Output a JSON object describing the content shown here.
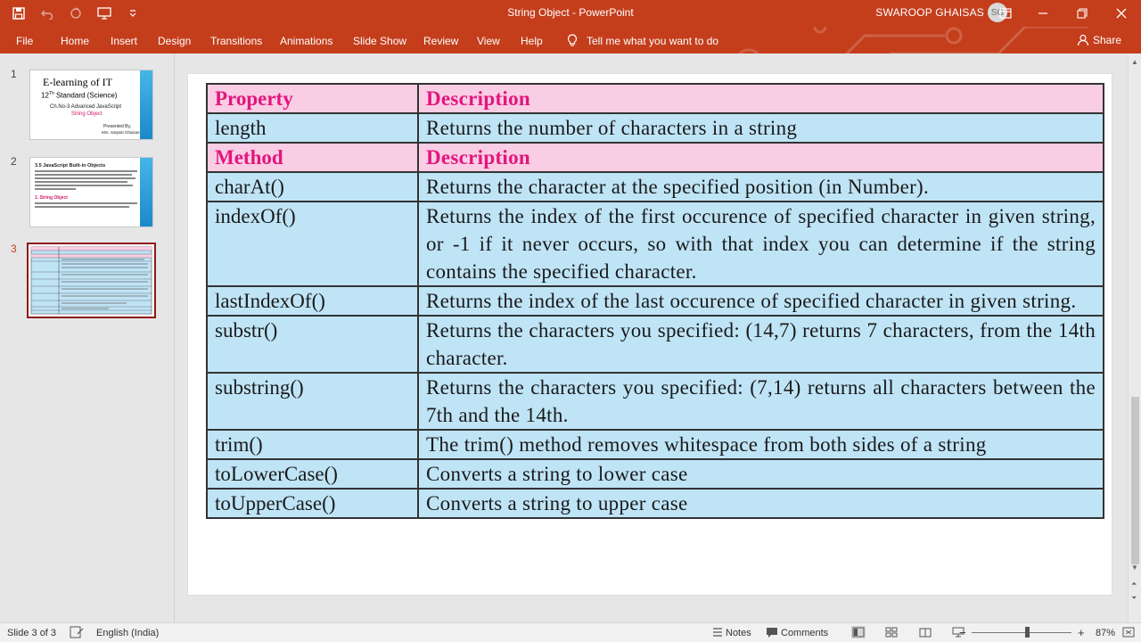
{
  "window": {
    "title": "String Object  -  PowerPoint",
    "user_name": "SWAROOP GHAISAS",
    "user_initials": "SG"
  },
  "ribbon": {
    "tabs": [
      "File",
      "Home",
      "Insert",
      "Design",
      "Transitions",
      "Animations",
      "Slide Show",
      "Review",
      "View",
      "Help"
    ],
    "tell_me": "Tell me what you want to do",
    "share": "Share"
  },
  "thumbnails": {
    "numbers": [
      "1",
      "2",
      "3"
    ],
    "slide1": {
      "title": "E-learning of IT",
      "standard_num": "12",
      "standard_sup": "Th",
      "standard_rest": " Standard (Science)",
      "chapter": "Ch.No-3 Advanced JavaScript",
      "topic": "String Object",
      "presented_by": "Presented By,",
      "presenter": "Mrs. Satyaki Ghaisas"
    },
    "slide2": {
      "title": "3.5 JavaScript Built-in Objects",
      "subheading": "1. String Object"
    }
  },
  "table": {
    "header1": [
      "Property",
      "Description"
    ],
    "header2": [
      "Method",
      "Description"
    ],
    "property_rows": [
      [
        "length",
        "Returns the number of characters in a string"
      ]
    ],
    "method_rows": [
      [
        "charAt()",
        "Returns the character at the specified position (in Number)."
      ],
      [
        "indexOf()",
        "Returns the index of the first occurence of specified character in given string, or -1 if it never occurs, so with that index you can determine if the string contains the specified character."
      ],
      [
        "lastIndexOf()",
        "Returns the index of the last occurence of specified character in given string."
      ],
      [
        "substr()",
        "Returns the characters you specified: (14,7) returns 7 characters, from the 14th character."
      ],
      [
        "substring()",
        "Returns the characters you specified: (7,14) returns all characters between the 7th and the 14th."
      ],
      [
        "trim()",
        "The trim() method removes whitespace from both sides of a string"
      ],
      [
        "toLowerCase()",
        "Converts a string to lower case"
      ],
      [
        "toUpperCase()",
        "Converts a string to upper case"
      ]
    ]
  },
  "status": {
    "slide_info": "Slide 3 of 3",
    "language": "English (India)",
    "notes": "Notes",
    "comments": "Comments",
    "zoom": "87%"
  },
  "colors": {
    "accent": "#c43e1c",
    "header_pink": "#f9cde3",
    "header_text": "#e3157e",
    "cell_blue": "#bfe4f6",
    "selected_thumb_border": "#8b1a1a"
  }
}
